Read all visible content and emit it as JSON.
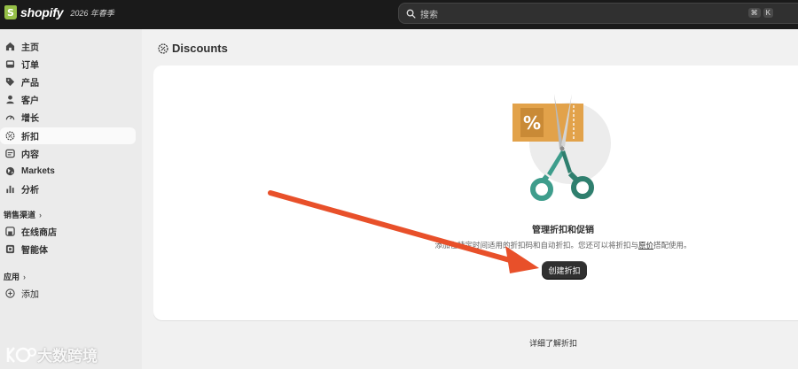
{
  "topbar": {
    "logo_text": "shopify",
    "edition": "2026 年春季",
    "search_placeholder": "搜索",
    "shortcut": [
      "⌘",
      "K"
    ]
  },
  "sidebar": {
    "items": [
      {
        "label": "主页",
        "icon": "home-icon"
      },
      {
        "label": "订单",
        "icon": "inbox-icon"
      },
      {
        "label": "产品",
        "icon": "tag-icon"
      },
      {
        "label": "客户",
        "icon": "person-icon"
      },
      {
        "label": "增长",
        "icon": "gauge-icon"
      },
      {
        "label": "折扣",
        "icon": "discount-icon",
        "active": true
      },
      {
        "label": "内容",
        "icon": "content-icon"
      },
      {
        "label": "Markets",
        "icon": "globe-icon"
      },
      {
        "label": "分析",
        "icon": "bar-chart-icon"
      }
    ],
    "sales_channels_label": "销售渠道",
    "channels": [
      {
        "label": "在线商店",
        "icon": "store-icon"
      },
      {
        "label": "智能体",
        "icon": "agent-icon"
      }
    ],
    "apps_label": "应用",
    "add_label": "添加"
  },
  "main": {
    "title": "Discounts",
    "empty_state": {
      "heading": "管理折扣和促销",
      "description_prefix": "添加在特定时间适用的折扣码和自动折扣。您还可以将折扣与",
      "description_link": "原价",
      "description_suffix": "搭配使用。",
      "primary_action": "创建折扣"
    },
    "learn_more": "详细了解折扣"
  },
  "watermark": "大数跨境",
  "colors": {
    "topbar": "#1a1a1a",
    "sidebar": "#ebebeb",
    "primary_button": "#303030",
    "annotation_arrow": "#e8502a",
    "coupon": "#e2a24a"
  }
}
